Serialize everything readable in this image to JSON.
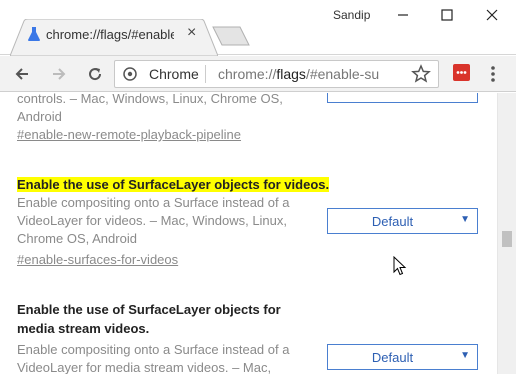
{
  "window": {
    "user": "Sandip",
    "minimize_icon": "minimize-icon",
    "maximize_icon": "maximize-icon",
    "close_icon": "close-icon"
  },
  "tab": {
    "title": "chrome://flags/#enable-",
    "close": "×",
    "icon": "flask-icon"
  },
  "toolbar": {
    "omnibox_chip": "Chrome",
    "url_prefix": "chrome://",
    "url_host": "flags",
    "url_suffix": "/#enable-su"
  },
  "flags": [
    {
      "desc_tail": "controls. – Mac, Windows, Linux, Chrome OS, Android",
      "link": "#enable-new-remote-playback-pipeline"
    },
    {
      "title": "Enable the use of SurfaceLayer objects for videos.",
      "desc": "Enable compositing onto a Surface instead of a VideoLayer for videos. – Mac, Windows, Linux, Chrome OS, Android",
      "link": "#enable-surfaces-for-videos",
      "select_value": "Default"
    },
    {
      "title": "Enable the use of SurfaceLayer objects for media stream videos.",
      "desc": "Enable compositing onto a Surface instead of a VideoLayer for media stream videos. – Mac,",
      "select_value": "Default"
    }
  ],
  "colors": {
    "highlight": "#ffff00",
    "accent": "#2d5fb3"
  }
}
